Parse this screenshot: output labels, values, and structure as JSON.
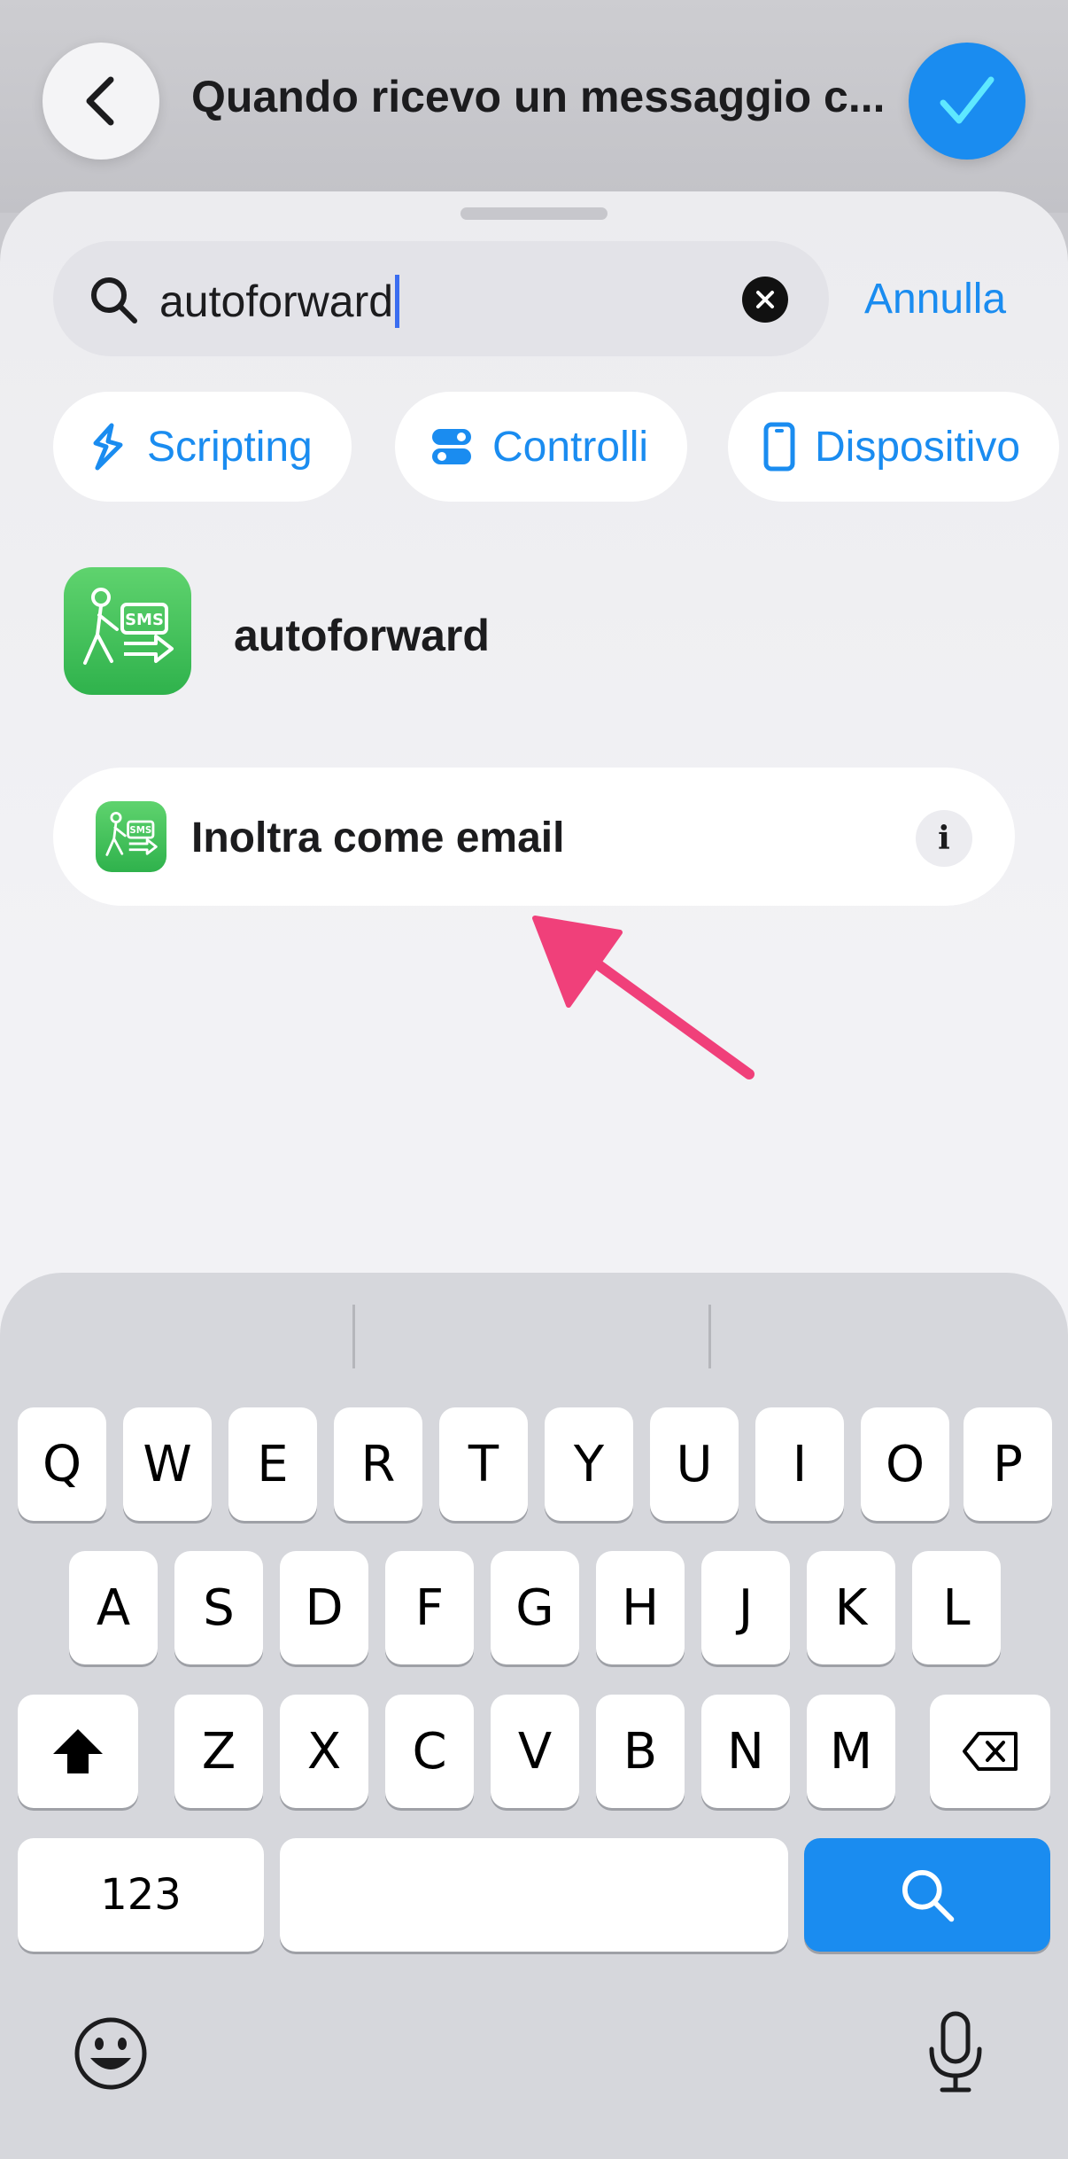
{
  "header": {
    "title": "Quando ricevo un messaggio c...",
    "back_icon": "chevron-left-icon",
    "done_icon": "checkmark-icon",
    "done_color": "#1a8cf0"
  },
  "search": {
    "value": "autoforward",
    "cancel_label": "Annulla"
  },
  "filters": [
    {
      "label": "Scripting",
      "icon": "scripting-icon"
    },
    {
      "label": "Controlli",
      "icon": "toggles-icon"
    },
    {
      "label": "Dispositivo",
      "icon": "phone-icon"
    }
  ],
  "result": {
    "app_name": "autoforward",
    "action_label": "Inoltra come email",
    "info_symbol": "i",
    "icon_badge": "SMS"
  },
  "annotation_color": "#f0407a",
  "keyboard": {
    "row1": [
      "Q",
      "W",
      "E",
      "R",
      "T",
      "Y",
      "U",
      "I",
      "O",
      "P"
    ],
    "row2": [
      "A",
      "S",
      "D",
      "F",
      "G",
      "H",
      "J",
      "K",
      "L"
    ],
    "row3": [
      "Z",
      "X",
      "C",
      "V",
      "B",
      "N",
      "M"
    ],
    "numbers_label": "123",
    "accent": "#1a8cf0"
  }
}
